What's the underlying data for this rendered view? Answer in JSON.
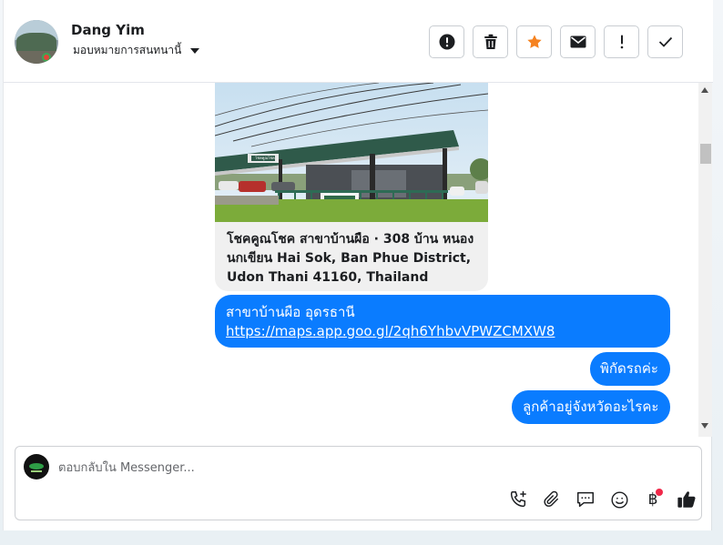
{
  "header": {
    "user_name": "Dang Yim",
    "assign_label": "มอบหมายการสนทนานี้",
    "actions": [
      {
        "name": "spam-report",
        "icon": "exclamation-circle-icon"
      },
      {
        "name": "delete",
        "icon": "trash-icon"
      },
      {
        "name": "star",
        "icon": "star-icon",
        "color": "#f58220"
      },
      {
        "name": "mark-unread",
        "icon": "envelope-icon"
      },
      {
        "name": "follow-up",
        "icon": "exclamation-icon"
      },
      {
        "name": "mark-done",
        "icon": "checkmark-icon"
      }
    ]
  },
  "messages": {
    "location_card": {
      "text": "โชคคูณโชค สาขาบ้านผือ · 308 บ้าน หนองนกเขียน Hai Sok, Ban Phue District, Udon Thani 41160, Thailand",
      "sign_text": "โชคคูณโชค"
    },
    "bubble1_line1": "สาขาบ้านผือ อุดรธานี",
    "bubble1_link": "https://maps.app.goo.gl/2qh6YhbvVPWZCMXW8",
    "bubble2": "พิกัดรถค่ะ",
    "bubble3": "ลูกค้าอยู่จังหวัดอะไรคะ"
  },
  "composer": {
    "placeholder": "ตอบกลับใน Messenger...",
    "value": "",
    "tools": [
      "phone-plus-icon",
      "paperclip-icon",
      "chat-bubble-icon",
      "emoji-icon",
      "baht-icon",
      "thumbs-up-icon"
    ],
    "baht_symbol": "฿"
  },
  "colors": {
    "bubble": "#0a7cff",
    "star": "#f58220",
    "badge": "#f02849"
  }
}
